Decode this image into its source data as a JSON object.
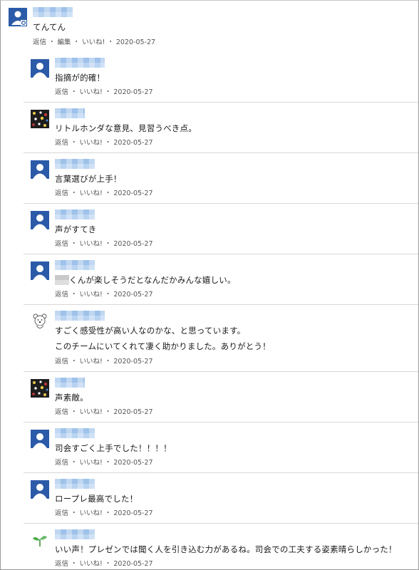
{
  "top_comment": {
    "text": "てんてん",
    "actions": {
      "reply": "返信",
      "edit": "編集",
      "like": "いいね!",
      "date": "2020-05-27"
    }
  },
  "separator": "・",
  "replies": [
    {
      "avatar": "default-user-icon",
      "text": "指摘が的確！",
      "reply": "返信",
      "like": "いいね!",
      "date": "2020-05-27"
    },
    {
      "avatar": "photo-avatar-icon",
      "text": "リトルホンダな意見、見習うべき点。",
      "reply": "返信",
      "like": "いいね!",
      "date": "2020-05-27"
    },
    {
      "avatar": "default-user-icon",
      "text": "言葉選びが上手！",
      "reply": "返信",
      "like": "いいね!",
      "date": "2020-05-27"
    },
    {
      "avatar": "default-user-icon",
      "text": "声がすてき",
      "reply": "返信",
      "like": "いいね!",
      "date": "2020-05-27"
    },
    {
      "avatar": "default-user-icon",
      "text": "くんが楽しそうだとなんだかみんな嬉しい。",
      "reply": "返信",
      "like": "いいね!",
      "date": "2020-05-27"
    },
    {
      "avatar": "bear-avatar-icon",
      "text": "すごく感受性が高い人なのかな、と思っています。",
      "text2": "このチームにいてくれて凄く助かりました。ありがとう！",
      "reply": "返信",
      "like": "いいね!",
      "date": "2020-05-27"
    },
    {
      "avatar": "photo-avatar-icon",
      "text": "声素敵。",
      "reply": "返信",
      "like": "いいね!",
      "date": "2020-05-27"
    },
    {
      "avatar": "default-user-icon",
      "text": "司会すごく上手でした！！！！",
      "reply": "返信",
      "like": "いいね!",
      "date": "2020-05-27"
    },
    {
      "avatar": "default-user-icon",
      "text": "ロープレ最高でした！",
      "reply": "返信",
      "like": "いいね!",
      "date": "2020-05-27"
    },
    {
      "avatar": "sprout-avatar-icon",
      "text": "いい声！プレゼンでは聞く人を引き込む力があるね。司会での工夫する姿素晴らしかった！",
      "reply": "返信",
      "like": "いいね!",
      "date": "2020-05-27"
    }
  ],
  "colors": {
    "avatar_blue": "#2b5aa8",
    "redacted_name": "#9ec2ea",
    "divider": "#d8d8d8"
  }
}
